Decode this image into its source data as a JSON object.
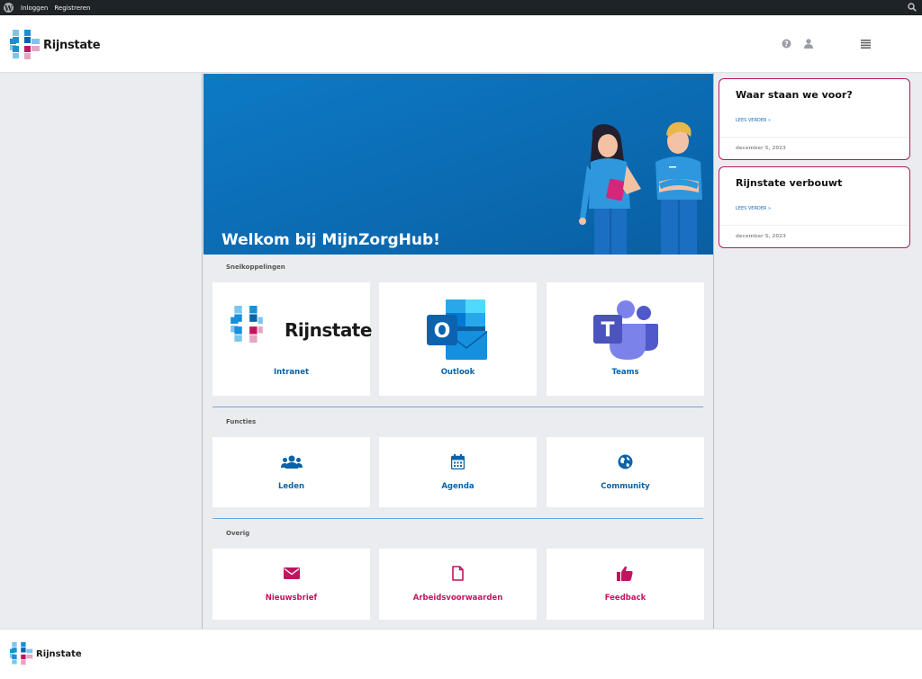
{
  "adminbar": {
    "login": "Inloggen",
    "register": "Registreren"
  },
  "brand": {
    "name": "Rijnstate"
  },
  "hero": {
    "title": "Welkom bij MijnZorgHub!"
  },
  "sections": {
    "shortcuts": {
      "label": "Snelkoppelingen",
      "cards": [
        {
          "label": "Intranet",
          "logo_text": "Rijnstate"
        },
        {
          "label": "Outlook",
          "icon_letter": "O"
        },
        {
          "label": "Teams",
          "icon_letter": "T"
        }
      ]
    },
    "functions": {
      "label": "Functies",
      "cards": [
        {
          "label": "Leden",
          "icon": "users-icon"
        },
        {
          "label": "Agenda",
          "icon": "calendar-icon"
        },
        {
          "label": "Community",
          "icon": "globe-icon"
        }
      ]
    },
    "other": {
      "label": "Overig",
      "cards": [
        {
          "label": "Nieuwsbrief",
          "icon": "envelope-icon"
        },
        {
          "label": "Arbeidsvoorwaarden",
          "icon": "document-icon"
        },
        {
          "label": "Feedback",
          "icon": "thumbs-up-icon"
        }
      ]
    }
  },
  "news": [
    {
      "title": "Waar staan we voor?",
      "read_more": "LEES VERDER »",
      "date": "december 5, 2023"
    },
    {
      "title": "Rijnstate verbouwt",
      "read_more": "LEES VERDER »",
      "date": "december 5, 2023"
    }
  ],
  "colors": {
    "primary": "#0a63a8",
    "accent": "#c3145f",
    "hero": "#0a6fb8"
  }
}
